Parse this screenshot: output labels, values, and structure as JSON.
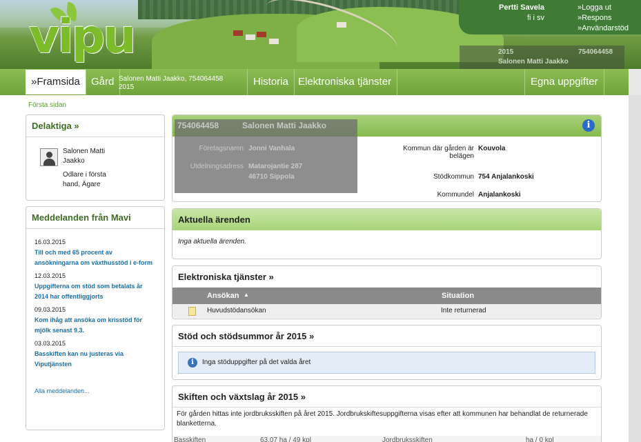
{
  "logo": {
    "text": "vipu"
  },
  "user": {
    "name": "Pertti Savela",
    "languages": "fi i sv",
    "links": [
      "»Logga ut",
      "»Respons",
      "»Användarstöd"
    ]
  },
  "farm_badge": {
    "year": "2015",
    "id": "754064458",
    "name": "Salonen Matti Jaakko"
  },
  "nav": {
    "items": [
      "»Framsida",
      "Gård",
      "Historia",
      "Elektroniska tjänster",
      "Egna uppgifter"
    ],
    "farm_line1": "Salonen Matti Jaakko, 754064458",
    "farm_line2": "2015"
  },
  "breadcrumb": "Första sidan",
  "delaktiga": {
    "title": "Delaktiga »",
    "name": "Salonen Matti Jaakko",
    "role": "Odlare i första hand, Ägare"
  },
  "mavi": {
    "title": "Meddelanden från Mavi",
    "items": [
      {
        "date": "16.03.2015",
        "text": "Till och med 65 procent av ansökningarna om växthusstöd i e-form"
      },
      {
        "date": "12.03.2015",
        "text": "Uppgifterna om stöd som betalats år 2014 har offentliggjorts"
      },
      {
        "date": "09.03.2015",
        "text": "Kom ihåg att ansöka om krisstöd för mjölk senast 9.3."
      },
      {
        "date": "03.03.2015",
        "text": "Basskiften kan nu justeras via Viputjänsten"
      }
    ],
    "all_link": "Alla meddelanden..."
  },
  "farm": {
    "id": "754064458",
    "holder": "Salonen Matti Jaakko",
    "company_label": "Företagsnamn",
    "company_value": "Jonni Vanhala",
    "address_label": "Utdelningsadress",
    "address_line1": "Matarojantie 287",
    "address_line2": "46710  Sippola",
    "municipality_label": "Kommun där gården är belägen",
    "municipality_value": "Kouvola",
    "support_label": "Stödkommun",
    "support_value": "754 Anjalankoski",
    "district_label": "Kommundel",
    "district_value": "Anjalankoski"
  },
  "aktuella": {
    "title": "Aktuella ärenden",
    "text": "Inga aktuella ärenden."
  },
  "etj": {
    "title": "Elektroniska tjänster »",
    "col1": "Ansökan",
    "sort_icon": "sort-up-icon",
    "col2": "Situation",
    "row_app": "Huvudstödansökan",
    "row_status": "Inte returnerad"
  },
  "stod": {
    "title": "Stöd och stödsummor år 2015 »",
    "notice": "Inga stöduppgifter på det valda året"
  },
  "skiften": {
    "title": "Skiften och växtslag år 2015 »",
    "text": "För gården hittas inte jordbruksskiften på året 2015. Jordbrukskiftesuppgifterna visas efter att kommunen har behandlat de returnerade blanketterna.",
    "row": [
      "Basskiften",
      "63,07 ha / 49 kpl",
      "Jordbruksskiften",
      "ha / 0 kpl"
    ]
  },
  "colors": {
    "accent_green": "#7fb548",
    "title_green": "#3e6e25",
    "link_blue": "#1a6fa8"
  }
}
